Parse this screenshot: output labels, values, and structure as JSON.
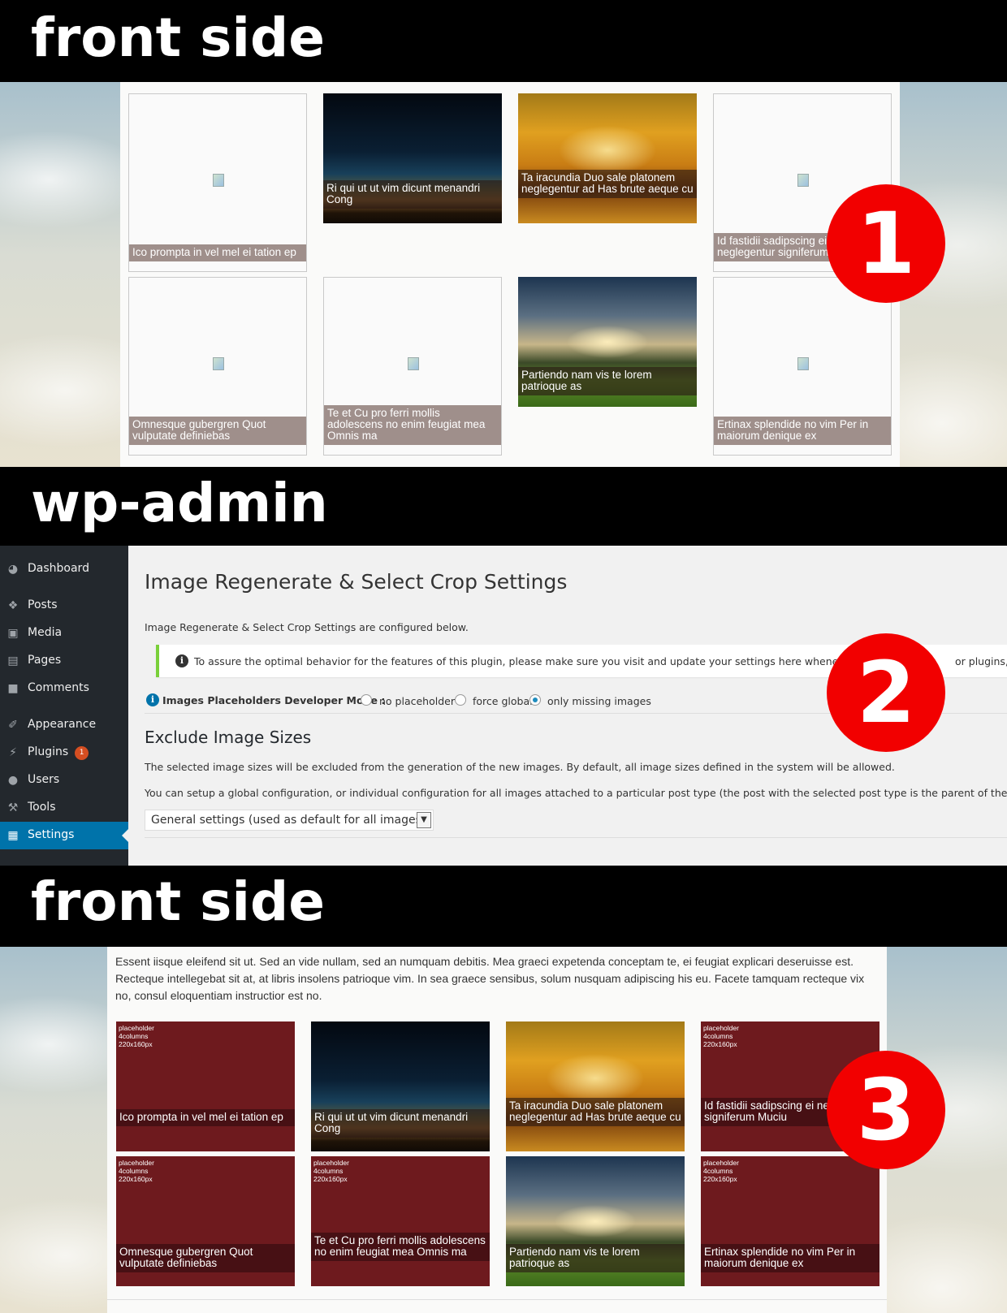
{
  "banners": {
    "top": "front side",
    "middle": "wp-admin",
    "bottom": "front side"
  },
  "markers": [
    "1",
    "2",
    "3"
  ],
  "front_top": {
    "tiles": [
      {
        "caption": "Ico prompta in vel mel ei tation ep",
        "image": "broken-image-icon"
      },
      {
        "caption": "Ri qui ut ut vim dicunt menandri Cong",
        "image": "night-sky-photo"
      },
      {
        "caption": "Ta iracundia Duo sale platonem neglegentur ad Has brute aeque cu",
        "image": "autumn-lake-photo"
      },
      {
        "caption": "Id fastidii sadipscing ei neglegentur signiferum Muciu",
        "image": "broken-image-icon"
      },
      {
        "caption": "Omnesque gubergren Quot vulputate definiebas",
        "image": "broken-image-icon"
      },
      {
        "caption": "Te et Cu pro ferri mollis adolescens no enim feugiat mea Omnis ma",
        "image": "broken-image-icon"
      },
      {
        "caption": "Partiendo nam vis te lorem patrioque as",
        "image": "field-sunset-photo"
      },
      {
        "caption": "Ertinax splendide no vim Per in maiorum denique ex",
        "image": "broken-image-icon"
      }
    ]
  },
  "admin": {
    "sidebar": [
      {
        "label": "Dashboard",
        "icon": "dashboard-icon"
      },
      {
        "label": "Posts",
        "icon": "pin-icon"
      },
      {
        "label": "Media",
        "icon": "media-icon"
      },
      {
        "label": "Pages",
        "icon": "pages-icon"
      },
      {
        "label": "Comments",
        "icon": "comment-icon"
      },
      {
        "label": "Appearance",
        "icon": "brush-icon"
      },
      {
        "label": "Plugins",
        "icon": "plugin-icon",
        "badge": "1"
      },
      {
        "label": "Users",
        "icon": "user-icon"
      },
      {
        "label": "Tools",
        "icon": "wrench-icon"
      },
      {
        "label": "Settings",
        "icon": "settings-icon",
        "active": true
      }
    ],
    "title": "Image Regenerate & Select Crop Settings",
    "description": "Image Regenerate & Select Crop Settings are configured below.",
    "notice": "To assure the optimal behavior for the features of this plugin, please make sure you visit and update your settings here whenever you",
    "notice_tail": "or plugins, so",
    "dev_mode": {
      "label": "Images Placeholders Developer Mode :",
      "options": [
        "no placeholder",
        "force global",
        "only missing images"
      ],
      "selected": "only missing images"
    },
    "exclude_title": "Exclude Image Sizes",
    "exclude_desc1": "The selected image sizes will be excluded from the generation of the new images. By default, all image sizes defined in the system will be allowed.",
    "exclude_desc2": "You can setup a global configuration, or individual configuration for all images attached to a particular post type (the post with the selected post type is the parent of the images). If",
    "select_value": "General settings (used as default for all images)",
    "accent_color": "#0073aa"
  },
  "front_bottom": {
    "paragraph": "Essent iisque eleifend sit ut. Sed an vide nullam, sed an numquam debitis. Mea graeci expetenda conceptam te, ei feugiat explicari deseruisse est. Recteque intellegebat sit at, at libris insolens patrioque vim. In sea graece sensibus, solum nusquam adipiscing his eu. Facete tamquam recteque vix no, consul eloquentiam instructior est no.",
    "placeholder_label": "placeholder\n4columns\n220x160px",
    "placeholder_color": "#6e1a1e",
    "tiles": [
      {
        "caption": "Ico prompta in vel mel ei tation ep",
        "image": "placeholder"
      },
      {
        "caption": "Ri qui ut ut vim dicunt menandri Cong",
        "image": "night-sky-photo"
      },
      {
        "caption": "Ta iracundia Duo sale platonem neglegentur ad Has brute aeque cu",
        "image": "autumn-lake-photo"
      },
      {
        "caption": "Id fastidii sadipscing ei neglegentur signiferum Muciu",
        "image": "placeholder"
      },
      {
        "caption": "Omnesque gubergren Quot vulputate definiebas",
        "image": "placeholder"
      },
      {
        "caption": "Te et Cu pro ferri mollis adolescens no enim feugiat mea Omnis ma",
        "image": "placeholder"
      },
      {
        "caption": "Partiendo nam vis te lorem patrioque as",
        "image": "field-sunset-photo"
      },
      {
        "caption": "Ertinax splendide no vim Per in maiorum denique ex",
        "image": "placeholder"
      }
    ]
  }
}
